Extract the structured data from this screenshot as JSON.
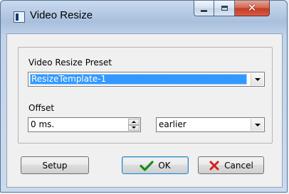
{
  "window": {
    "title": "Video Resize",
    "icon": "app-window-icon"
  },
  "controls": {
    "minimize": "minimize-icon",
    "maximize": "maximize-icon",
    "close": "close-icon"
  },
  "preset": {
    "label": "Video Resize Preset",
    "selected": "ResizeTemplate-1"
  },
  "offset": {
    "label": "Offset",
    "value": "0 ms.",
    "direction": "earlier"
  },
  "buttons": {
    "setup": "Setup",
    "ok": "OK",
    "cancel": "Cancel"
  },
  "colors": {
    "selection": "#3399ff",
    "ok_check": "#1a8a1a",
    "cancel_cross": "#d4201a",
    "close_button": "#c33b26"
  }
}
